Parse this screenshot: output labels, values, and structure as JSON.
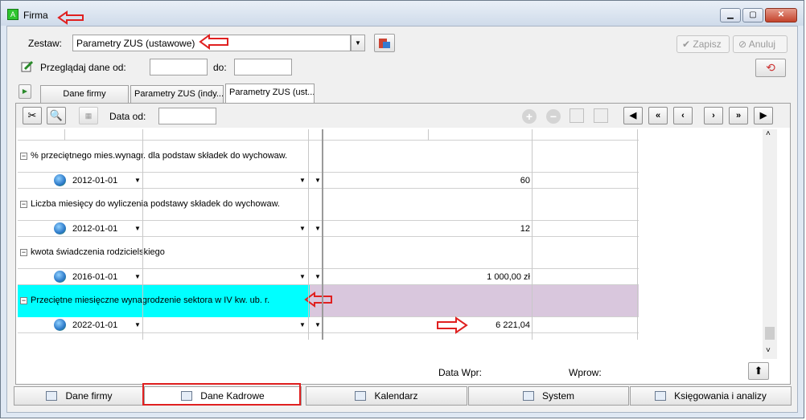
{
  "window": {
    "title": "Firma"
  },
  "form": {
    "zestaw_label": "Zestaw:",
    "zestaw_value": "Parametry ZUS (ustawowe)",
    "przegladaj_label": "Przeglądaj dane od:",
    "do_label": "do:",
    "zapisz_label": "Zapisz",
    "anuluj_label": "Anuluj"
  },
  "tabs": [
    {
      "label": "Dane firmy"
    },
    {
      "label": "Parametry ZUS (indy..."
    },
    {
      "label": "Parametry ZUS (ust..."
    }
  ],
  "panel": {
    "data_od_label": "Data od:",
    "footer_data_wpr": "Data Wpr:",
    "footer_wprow": "Wprow:"
  },
  "groups": [
    {
      "label": "% przeciętnego mies.wynagr. dla podstaw składek do wychowaw.",
      "date": "2012-01-01",
      "value": "60"
    },
    {
      "label": "Liczba miesięcy do wyliczenia podstawy składek do wychowaw.",
      "date": "2012-01-01",
      "value": "12"
    },
    {
      "label": "kwota świadczenia rodzicielskiego",
      "date": "2016-01-01",
      "value": "1 000,00 zł"
    },
    {
      "label": "Przeciętne miesięczne wynagrodzenie sektora w IV kw. ub. r.",
      "date": "2022-01-01",
      "value": "6 221,04"
    }
  ],
  "bottom_tabs": [
    {
      "label": "Dane firmy"
    },
    {
      "label": "Dane Kadrowe"
    },
    {
      "label": "Kalendarz"
    },
    {
      "label": "System"
    },
    {
      "label": "Księgowania i analizy"
    }
  ],
  "colors": {
    "highlight_label": "#00ffff",
    "highlight_row": "#d9c7dd",
    "annotation": "#e02020"
  }
}
